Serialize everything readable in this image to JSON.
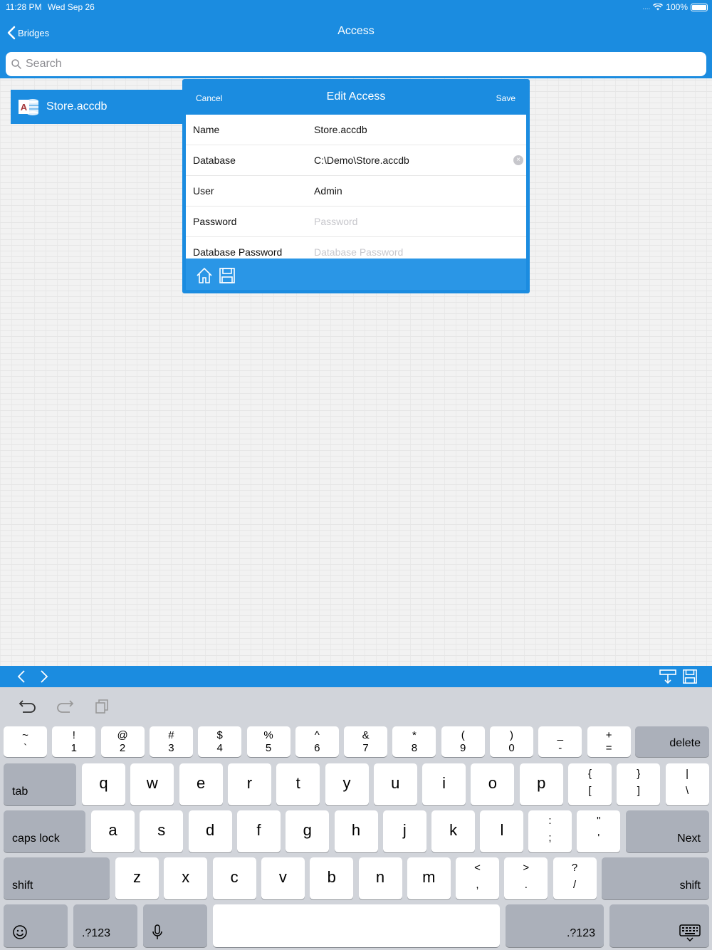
{
  "status_bar": {
    "time": "11:28 PM",
    "date": "Wed Sep 26",
    "signal": "....",
    "battery": "100%"
  },
  "nav": {
    "back_label": "Bridges",
    "title": "Access"
  },
  "search": {
    "placeholder": "Search"
  },
  "list": {
    "item_label": "Store.accdb"
  },
  "popover": {
    "cancel": "Cancel",
    "title": "Edit Access",
    "save": "Save",
    "fields": [
      {
        "label": "Name",
        "value": "Store.accdb",
        "placeholder": ""
      },
      {
        "label": "Database",
        "value": "C:\\Demo\\Store.accdb",
        "placeholder": ""
      },
      {
        "label": "User",
        "value": "Admin",
        "placeholder": ""
      },
      {
        "label": "Password",
        "value": "",
        "placeholder": "Password"
      },
      {
        "label": "Database Password",
        "value": "",
        "placeholder": "Database Password"
      }
    ]
  },
  "keyboard": {
    "row1": [
      [
        "~",
        "`"
      ],
      [
        "!",
        "1"
      ],
      [
        "@",
        "2"
      ],
      [
        "#",
        "3"
      ],
      [
        "$",
        "4"
      ],
      [
        "%",
        "5"
      ],
      [
        "^",
        "6"
      ],
      [
        "&",
        "7"
      ],
      [
        "*",
        "8"
      ],
      [
        "(",
        "9"
      ],
      [
        ")",
        "0"
      ],
      [
        "_",
        "-"
      ],
      [
        "+",
        "="
      ]
    ],
    "delete": "delete",
    "tab": "tab",
    "row2": [
      "q",
      "w",
      "e",
      "r",
      "t",
      "y",
      "u",
      "i",
      "o",
      "p"
    ],
    "row2_sym": [
      [
        "{",
        "["
      ],
      [
        "}",
        "]"
      ],
      [
        "|",
        "\\"
      ]
    ],
    "caps": "caps lock",
    "row3": [
      "a",
      "s",
      "d",
      "f",
      "g",
      "h",
      "j",
      "k",
      "l"
    ],
    "row3_sym": [
      [
        ":",
        ";"
      ],
      [
        "\"",
        "'"
      ]
    ],
    "next": "Next",
    "shift": "shift",
    "row4": [
      "z",
      "x",
      "c",
      "v",
      "b",
      "n",
      "m"
    ],
    "row4_sym": [
      [
        "<",
        ","
      ],
      [
        ">",
        "."
      ],
      [
        "?",
        "/"
      ]
    ],
    "numbers": ".?123"
  },
  "colors": {
    "accent": "#1b8ce0",
    "keyboard_bg": "#d1d4da"
  }
}
